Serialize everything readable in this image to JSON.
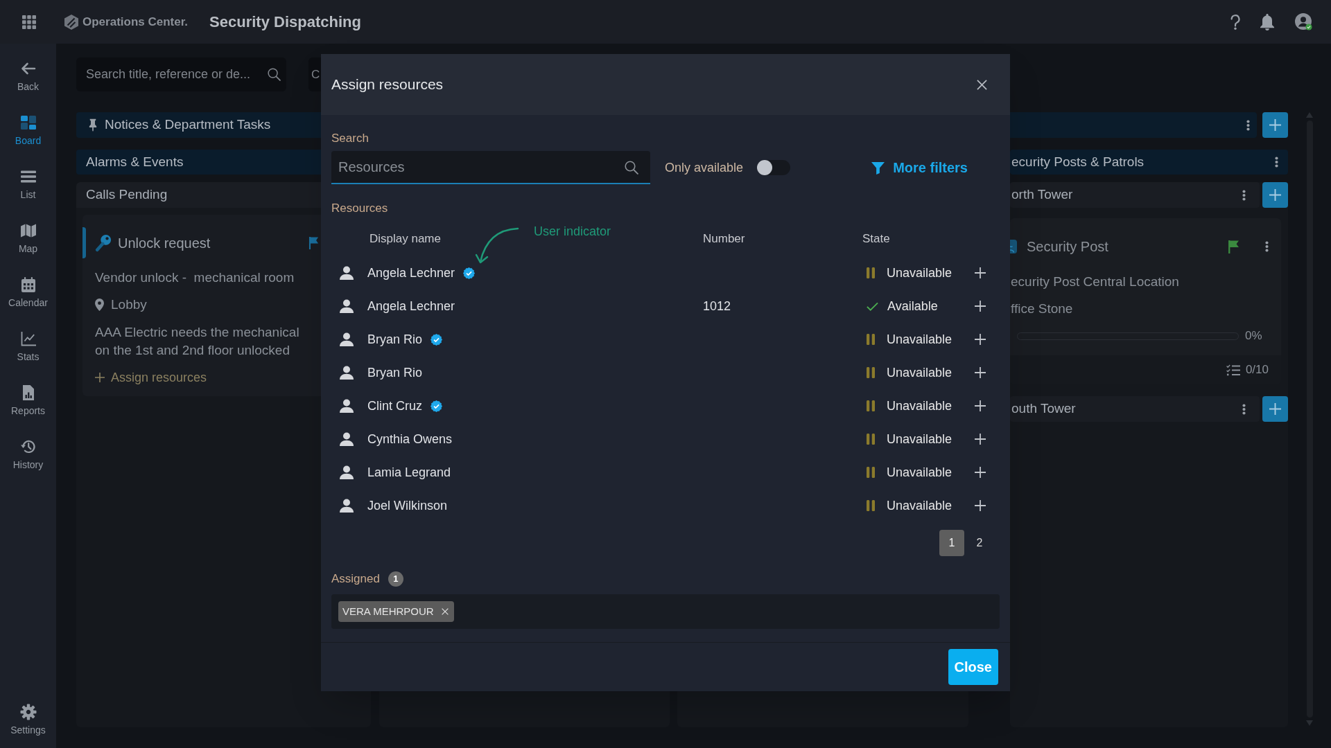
{
  "top_bar": {
    "app_name": "Operations Center.",
    "title": "Security Dispatching"
  },
  "sidebar": {
    "back": {
      "label": "Back"
    },
    "items": [
      {
        "label": "Board",
        "selected": true
      },
      {
        "label": "List",
        "selected": false
      },
      {
        "label": "Map",
        "selected": false
      },
      {
        "label": "Calendar",
        "selected": false
      },
      {
        "label": "Stats",
        "selected": false
      },
      {
        "label": "Reports",
        "selected": false
      },
      {
        "label": "History",
        "selected": false
      }
    ],
    "settings": {
      "label": "Settings"
    }
  },
  "board": {
    "search": {
      "placeholder": "Search title, reference or de..."
    },
    "filter_field": {
      "value": "C"
    },
    "notices": {
      "title": "Notices & Department Tasks"
    },
    "left_column": {
      "header": "Alarms & Events",
      "subheader": "Calls Pending",
      "cards": [
        {
          "title": "Unlock request",
          "color": "#1a6f9e",
          "subtitle": "Vendor unlock -  mechanical room",
          "location": "Lobby",
          "description_lines": [
            "AAA Electric needs the mechanical",
            "on the 1st and 2nd floor unlocked"
          ],
          "action": "Assign resources"
        }
      ]
    },
    "right_column": {
      "header": "ecurity Posts & Patrols",
      "groups": [
        {
          "title": "orth Tower",
          "cards": [
            {
              "title": "Security Post",
              "color": "#3b8a3f",
              "location": "ecurity Post Central Location",
              "site": "ffice Stone",
              "progress": {
                "level": 0,
                "reading": "0%"
              },
              "tasks": "0/10"
            }
          ]
        },
        {
          "title": "outh Tower"
        }
      ]
    }
  },
  "dialog": {
    "title": "Assign resources",
    "search": {
      "label": "Search",
      "placeholder": "Resources"
    },
    "only_available": {
      "label": "Only available",
      "on": false
    },
    "more_filters": "More filters",
    "resources": {
      "label": "Resources",
      "annotation": {
        "label": "User indicator"
      },
      "columns": [
        "Display name",
        "Number",
        "State"
      ],
      "rows": [
        {
          "name": "Angela Lechner",
          "verified": true,
          "state": "Unavailable",
          "available": false
        },
        {
          "name": "Angela Lechner",
          "verified": false,
          "number": "1012",
          "state": "Available",
          "available": true
        },
        {
          "name": "Bryan Rio",
          "verified": true,
          "state": "Unavailable",
          "available": false
        },
        {
          "name": "Bryan Rio",
          "verified": false,
          "state": "Unavailable",
          "available": false
        },
        {
          "name": "Clint Cruz",
          "verified": true,
          "state": "Unavailable",
          "available": false
        },
        {
          "name": "Cynthia Owens",
          "verified": false,
          "state": "Unavailable",
          "available": false
        },
        {
          "name": "Lamia Legrand",
          "verified": false,
          "state": "Unavailable",
          "available": false
        },
        {
          "name": "Joel Wilkinson",
          "verified": false,
          "state": "Unavailable",
          "available": false
        }
      ],
      "pages": [
        {
          "label": "1",
          "selected": true
        },
        {
          "label": "2",
          "selected": false
        }
      ]
    },
    "assigned": {
      "label": "Assigned",
      "count": "1",
      "items": [
        {
          "label": "VERA MEHRPOUR"
        }
      ]
    },
    "close_button": "Close"
  }
}
